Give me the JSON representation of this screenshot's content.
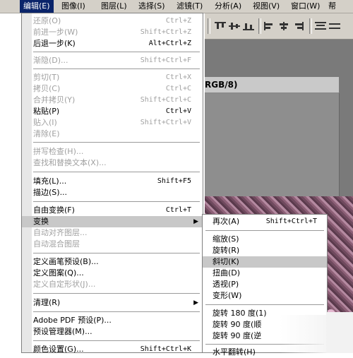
{
  "menubar": {
    "items": [
      {
        "label": "编辑(E)"
      },
      {
        "label": "图像(I)"
      },
      {
        "label": "图层(L)"
      },
      {
        "label": "选择(S)"
      },
      {
        "label": "滤镜(T)"
      },
      {
        "label": "分析(A)"
      },
      {
        "label": "视图(V)"
      },
      {
        "label": "窗口(W)"
      },
      {
        "label": "帮"
      }
    ]
  },
  "document": {
    "title": "RGB/8)"
  },
  "edit_menu": {
    "items": [
      {
        "label": "还原(O)",
        "shortcut": "Ctrl+Z",
        "enabled": false
      },
      {
        "label": "前进一步(W)",
        "shortcut": "Shift+Ctrl+Z",
        "enabled": false
      },
      {
        "label": "后退一步(K)",
        "shortcut": "Alt+Ctrl+Z",
        "enabled": true
      },
      {
        "label": "渐隐(D)...",
        "shortcut": "Shift+Ctrl+F",
        "enabled": false
      },
      {
        "label": "剪切(T)",
        "shortcut": "Ctrl+X",
        "enabled": false
      },
      {
        "label": "拷贝(C)",
        "shortcut": "Ctrl+C",
        "enabled": false
      },
      {
        "label": "合并拷贝(Y)",
        "shortcut": "Shift+Ctrl+C",
        "enabled": false
      },
      {
        "label": "粘贴(P)",
        "shortcut": "Ctrl+V",
        "enabled": true
      },
      {
        "label": "贴入(I)",
        "shortcut": "Shift+Ctrl+V",
        "enabled": false
      },
      {
        "label": "清除(E)",
        "shortcut": "",
        "enabled": false
      },
      {
        "label": "拼写检查(H)...",
        "shortcut": "",
        "enabled": false
      },
      {
        "label": "查找和替换文本(X)...",
        "shortcut": "",
        "enabled": false
      },
      {
        "label": "填充(L)...",
        "shortcut": "Shift+F5",
        "enabled": true
      },
      {
        "label": "描边(S)...",
        "shortcut": "",
        "enabled": true
      },
      {
        "label": "自由变换(F)",
        "shortcut": "Ctrl+T",
        "enabled": true
      },
      {
        "label": "变换",
        "shortcut": "",
        "enabled": true
      },
      {
        "label": "自动对齐图层...",
        "shortcut": "",
        "enabled": false
      },
      {
        "label": "自动混合图层",
        "shortcut": "",
        "enabled": false
      },
      {
        "label": "定义画笔预设(B)...",
        "shortcut": "",
        "enabled": true
      },
      {
        "label": "定义图案(Q)...",
        "shortcut": "",
        "enabled": true
      },
      {
        "label": "定义自定形状(J)...",
        "shortcut": "",
        "enabled": false
      },
      {
        "label": "清理(R)",
        "shortcut": "",
        "enabled": true
      },
      {
        "label": "Adobe PDF 预设(P)...",
        "shortcut": "",
        "enabled": true
      },
      {
        "label": "预设管理器(M)...",
        "shortcut": "",
        "enabled": true
      },
      {
        "label": "颜色设置(G)...",
        "shortcut": "Shift+Ctrl+K",
        "enabled": true
      }
    ]
  },
  "transform_submenu": {
    "items": [
      {
        "label": "再次(A)",
        "shortcut": "Shift+Ctrl+T"
      },
      {
        "label": "缩放(S)",
        "shortcut": ""
      },
      {
        "label": "旋转(R)",
        "shortcut": ""
      },
      {
        "label": "斜切(K)",
        "shortcut": ""
      },
      {
        "label": "扭曲(D)",
        "shortcut": ""
      },
      {
        "label": "透视(P)",
        "shortcut": ""
      },
      {
        "label": "变形(W)",
        "shortcut": ""
      },
      {
        "label": "旋转 180 度(1)",
        "shortcut": ""
      },
      {
        "label": "旋转 90 度(顺",
        "shortcut": ""
      },
      {
        "label": "旋转 90 度(逆",
        "shortcut": ""
      },
      {
        "label": "水平翻转(H)",
        "shortcut": ""
      }
    ]
  },
  "colors": {
    "menubar_active": "#0a246a",
    "selected_item": "#c8c8c8",
    "disabled_text": "#a0a0a0"
  }
}
